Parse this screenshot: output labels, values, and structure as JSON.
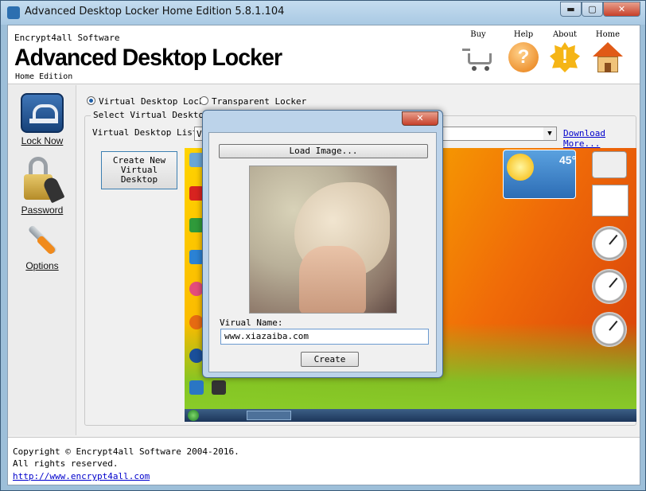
{
  "window": {
    "title": "Advanced Desktop Locker Home Edition 5.8.1.104",
    "min_label": "▬",
    "max_label": "▢",
    "close_label": "✕"
  },
  "header": {
    "company": "Encrypt4all Software",
    "app_name": "Advanced Desktop Locker",
    "edition": "Home Edition",
    "nav": [
      {
        "label": "Buy",
        "icon": "cart-icon"
      },
      {
        "label": "Help",
        "icon": "help-icon"
      },
      {
        "label": "About",
        "icon": "about-icon"
      },
      {
        "label": "Home",
        "icon": "home-icon"
      }
    ],
    "help_glyph": "?",
    "about_glyph": "!"
  },
  "sidebar": {
    "items": [
      {
        "label": "Lock Now",
        "icon": "lock-icon"
      },
      {
        "label": "Password",
        "icon": "padlock-key-icon"
      },
      {
        "label": "Options",
        "icon": "wrench-icon"
      }
    ]
  },
  "main": {
    "radio_virtual": "Virtual Desktop Lock",
    "radio_transparent": "Transparent Locker",
    "group_title": "Select Virtual Desktop",
    "list_label": "Virtual Desktop List:",
    "list_value": "V",
    "download_link": "Download More...",
    "create_button": "Create New\nVirtual\nDesktop",
    "weather_temp": "45°"
  },
  "dialog": {
    "close_label": "✕",
    "load_button": "Load Image...",
    "name_label": "Virual Name:",
    "name_value": "www.xiazaiba.com",
    "create_button": "Create"
  },
  "footer": {
    "copyright": "Copyright © Encrypt4all Software 2004-2016.",
    "rights": "All rights reserved.",
    "url": "http://www.encrypt4all.com"
  },
  "colors": {
    "accent": "#1e5fa8",
    "link": "#0000cc",
    "close_red": "#c7402a"
  }
}
